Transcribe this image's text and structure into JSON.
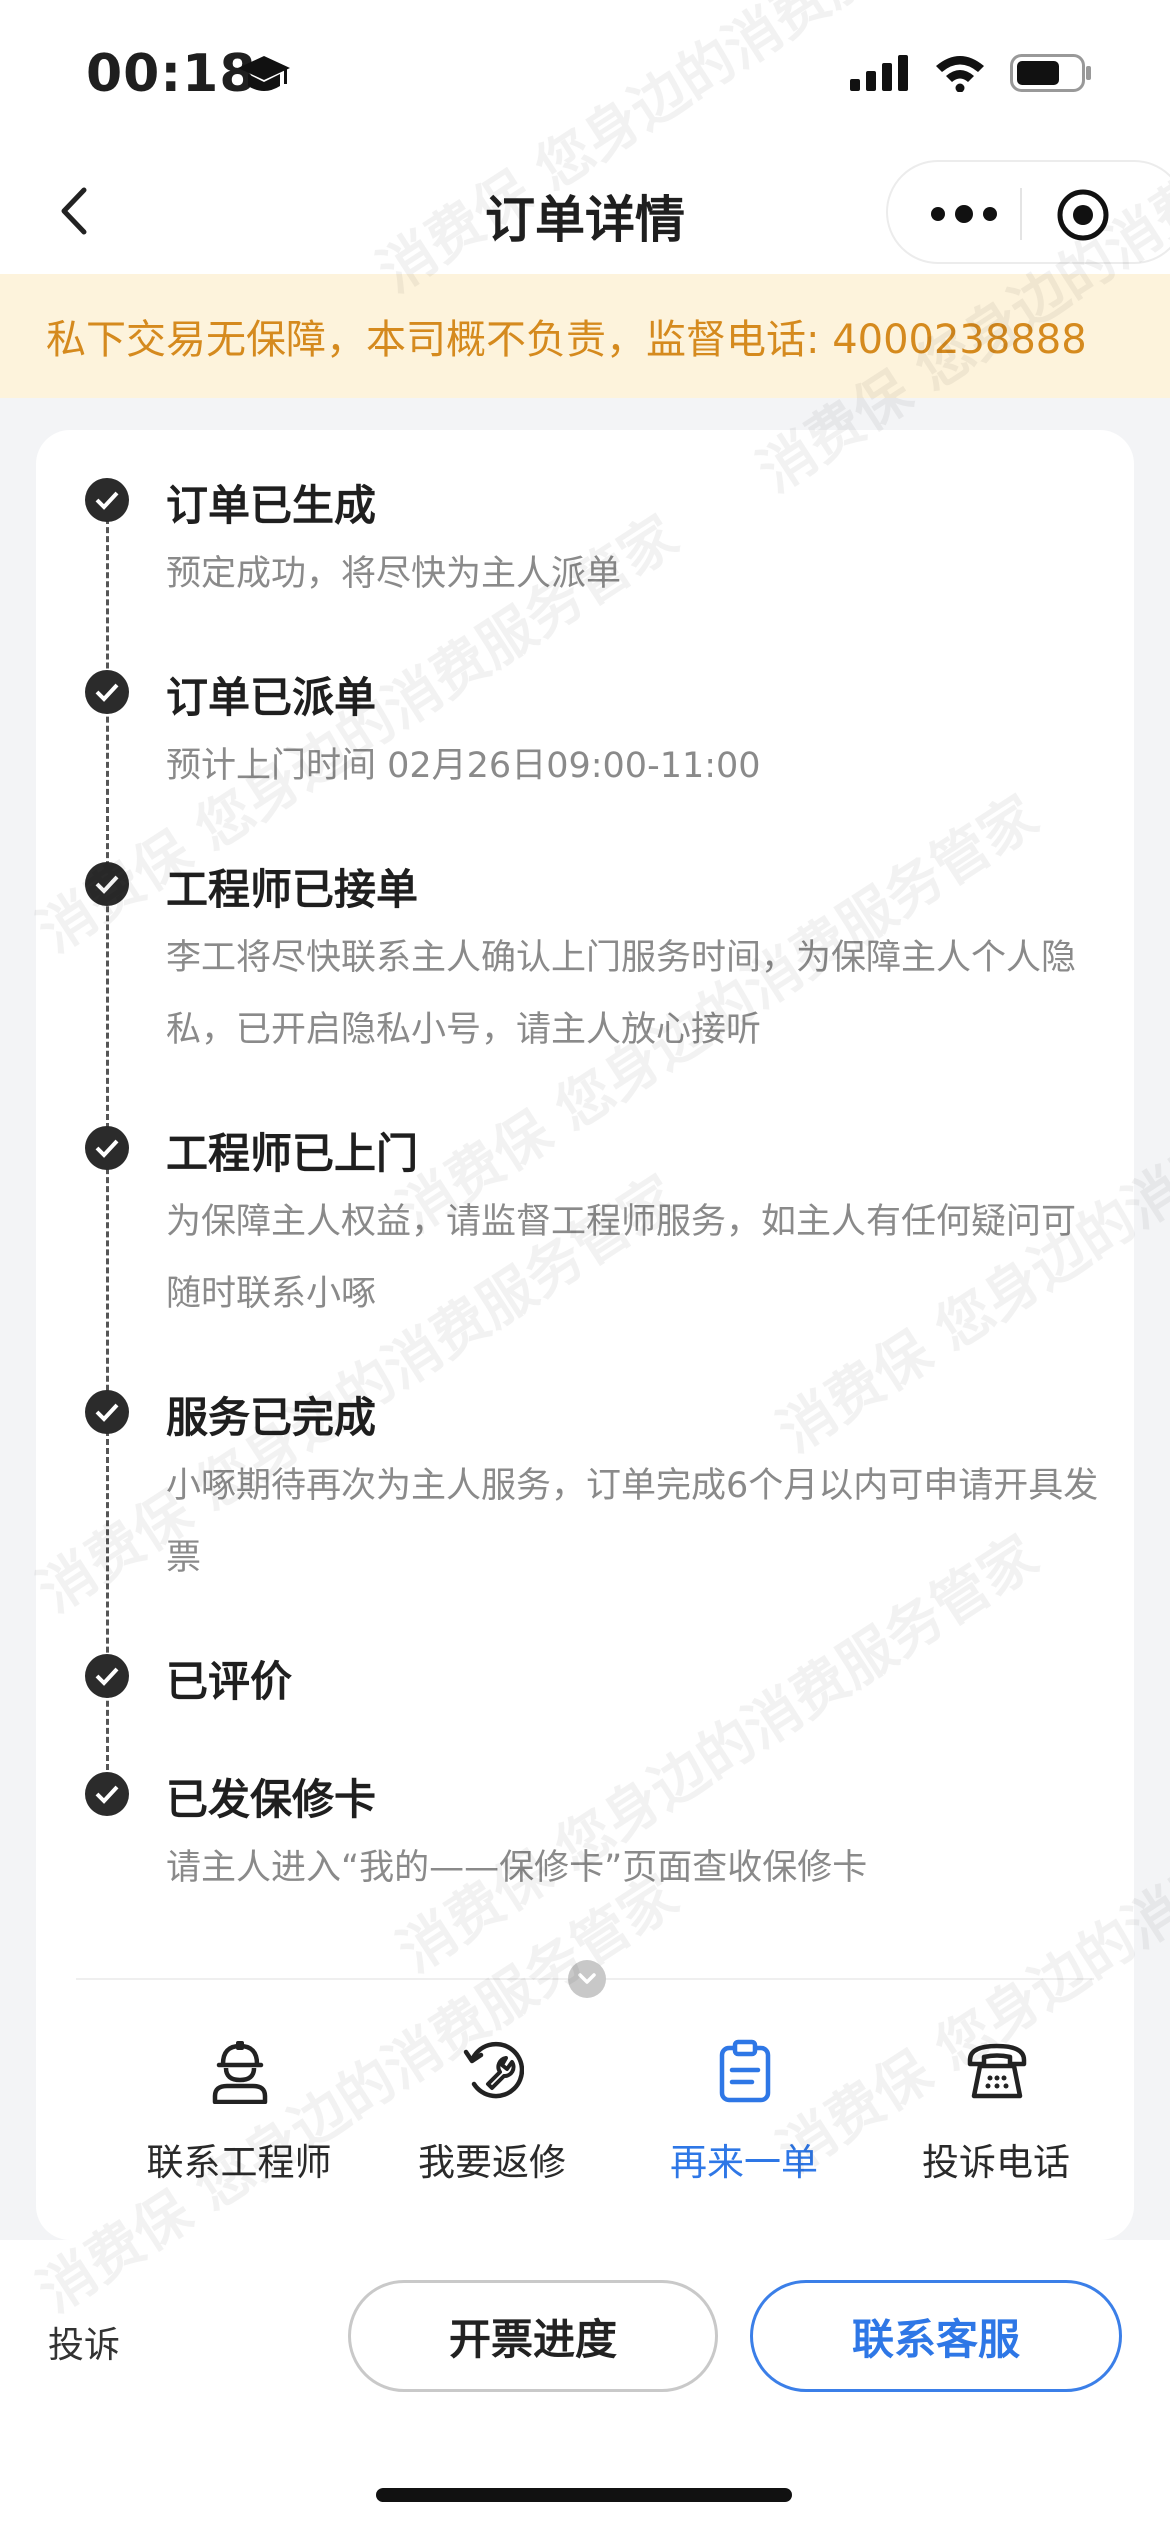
{
  "status_bar": {
    "time": "00:18"
  },
  "nav": {
    "title": "订单详情"
  },
  "banner": {
    "text": "私下交易无保障，本司概不负责，监督电话: 4000238888"
  },
  "timeline": [
    {
      "title": "订单已生成",
      "desc": "预定成功，将尽快为主人派单"
    },
    {
      "title": "订单已派单",
      "desc": "预计上门时间 02月26日09:00-11:00"
    },
    {
      "title": "工程师已接单",
      "desc": "李工将尽快联系主人确认上门服务时间，为保障主人个人隐私，已开启隐私小号，请主人放心接听"
    },
    {
      "title": "工程师已上门",
      "desc": "为保障主人权益，请监督工程师服务，如主人有任何疑问可随时联系小啄"
    },
    {
      "title": "服务已完成",
      "desc": "小啄期待再次为主人服务，订单完成6个月以内可申请开具发票"
    },
    {
      "title": "已评价",
      "desc": ""
    },
    {
      "title": "已发保修卡",
      "desc": "请主人进入“我的——保修卡”页面查收保修卡"
    }
  ],
  "actions": [
    {
      "label": "联系工程师",
      "icon": "engineer-icon"
    },
    {
      "label": "我要返修",
      "icon": "repair-icon"
    },
    {
      "label": "再来一单",
      "icon": "clipboard-icon",
      "active": true
    },
    {
      "label": "投诉电话",
      "icon": "phone-icon"
    }
  ],
  "bottom": {
    "complain_label": "投诉",
    "invoice_button": "开票进度",
    "service_button": "联系客服"
  },
  "watermark": {
    "text": "您身边的消费服务管家",
    "text2": "消费保"
  },
  "colors": {
    "accent": "#2e77e6",
    "banner_bg": "#fdf3dc",
    "banner_text": "#d58a1e"
  }
}
